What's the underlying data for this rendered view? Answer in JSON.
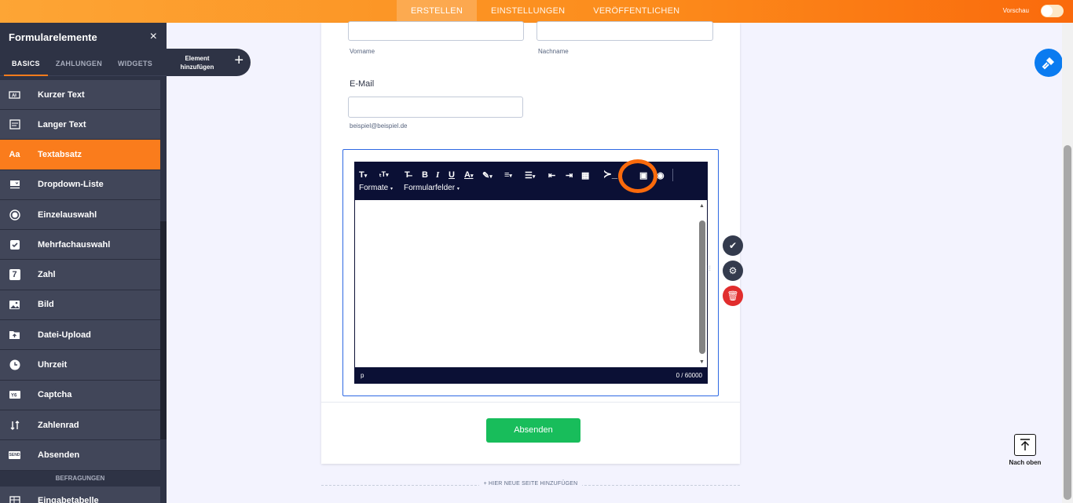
{
  "header": {
    "tabs": [
      {
        "label": "ERSTELLEN"
      },
      {
        "label": "EINSTELLUNGEN"
      },
      {
        "label": "VERÖFFENTLICHEN"
      }
    ],
    "preview_label": "Vorschau"
  },
  "sidebar": {
    "title": "Formularelemente",
    "close": "×",
    "tabs": [
      {
        "label": "BASICS"
      },
      {
        "label": "ZAHLUNGEN"
      },
      {
        "label": "WIDGETS"
      }
    ],
    "items": [
      {
        "label": "Kurzer Text",
        "icon": "short-text-icon"
      },
      {
        "label": "Langer Text",
        "icon": "long-text-icon"
      },
      {
        "label": "Textabsatz",
        "icon": "paragraph-icon",
        "glyph": "Aa"
      },
      {
        "label": "Dropdown-Liste",
        "icon": "dropdown-icon"
      },
      {
        "label": "Einzelauswahl",
        "icon": "radio-icon"
      },
      {
        "label": "Mehrfachauswahl",
        "icon": "checkbox-icon"
      },
      {
        "label": "Zahl",
        "icon": "number-icon",
        "glyph": "7"
      },
      {
        "label": "Bild",
        "icon": "image-icon"
      },
      {
        "label": "Datei-Upload",
        "icon": "upload-icon"
      },
      {
        "label": "Uhrzeit",
        "icon": "clock-icon"
      },
      {
        "label": "Captcha",
        "icon": "captcha-icon"
      },
      {
        "label": "Zahlenrad",
        "icon": "spinner-icon"
      },
      {
        "label": "Absenden",
        "icon": "send-icon",
        "glyph": "SEND"
      }
    ],
    "section_label": "BEFRAGUNGEN",
    "next_item": "Eingabetabelle"
  },
  "add_element": {
    "label": "Element hinzufügen",
    "plus": "+"
  },
  "form": {
    "firstname_sub": "Vorname",
    "lastname_sub": "Nachname",
    "email_label": "E-Mail",
    "email_sub": "beispiel@beispiel.de",
    "editor": {
      "formats_label": "Formate",
      "fields_label": "Formularfelder",
      "path": "p",
      "counter": "0 / 60000"
    },
    "submit_label": "Absenden"
  },
  "add_page": "+ HIER NEUE SEITE HINZUFÜGEN",
  "back_to_top": "Nach oben",
  "colors": {
    "accent": "#fa7c1c",
    "sidebar": "#2e3345",
    "submit": "#18bd5b",
    "delete": "#e12d2d",
    "paint": "#0a7bf0",
    "editor_bar": "#0b1035"
  }
}
